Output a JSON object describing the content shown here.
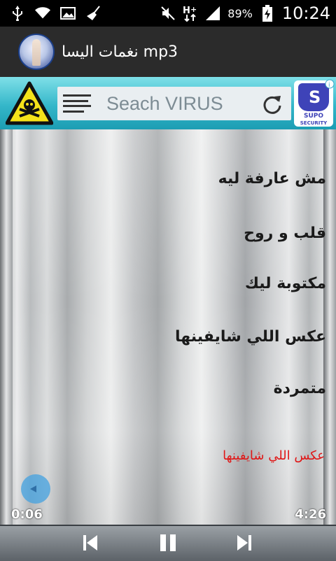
{
  "status_bar": {
    "icons": [
      "usb-icon",
      "wifi-icon",
      "image-icon",
      "broom-icon",
      "mute-icon",
      "data-icon",
      "signal-icon",
      "battery-charging-icon"
    ],
    "battery": "89%",
    "time": "10:24"
  },
  "app_bar": {
    "title": "نغمات اليسا mp3"
  },
  "ad": {
    "search_text": "Seach VIRUS",
    "brand": "SUPO",
    "brand_sub": "SECURITY"
  },
  "songs": [
    {
      "title": "مش عارفة ليه"
    },
    {
      "title": "قلب و روح"
    },
    {
      "title": "مكتوبة ليك"
    },
    {
      "title": "عكس اللي شايفينها"
    },
    {
      "title": "متمردة"
    }
  ],
  "player": {
    "now_playing": "عكس اللي شايفينها",
    "current_time": "0:06",
    "total_time": "4:26"
  },
  "colors": {
    "now_playing": "#e01616",
    "seek_handle": "#43a1e0",
    "ad_bg": "#34b6c9"
  }
}
